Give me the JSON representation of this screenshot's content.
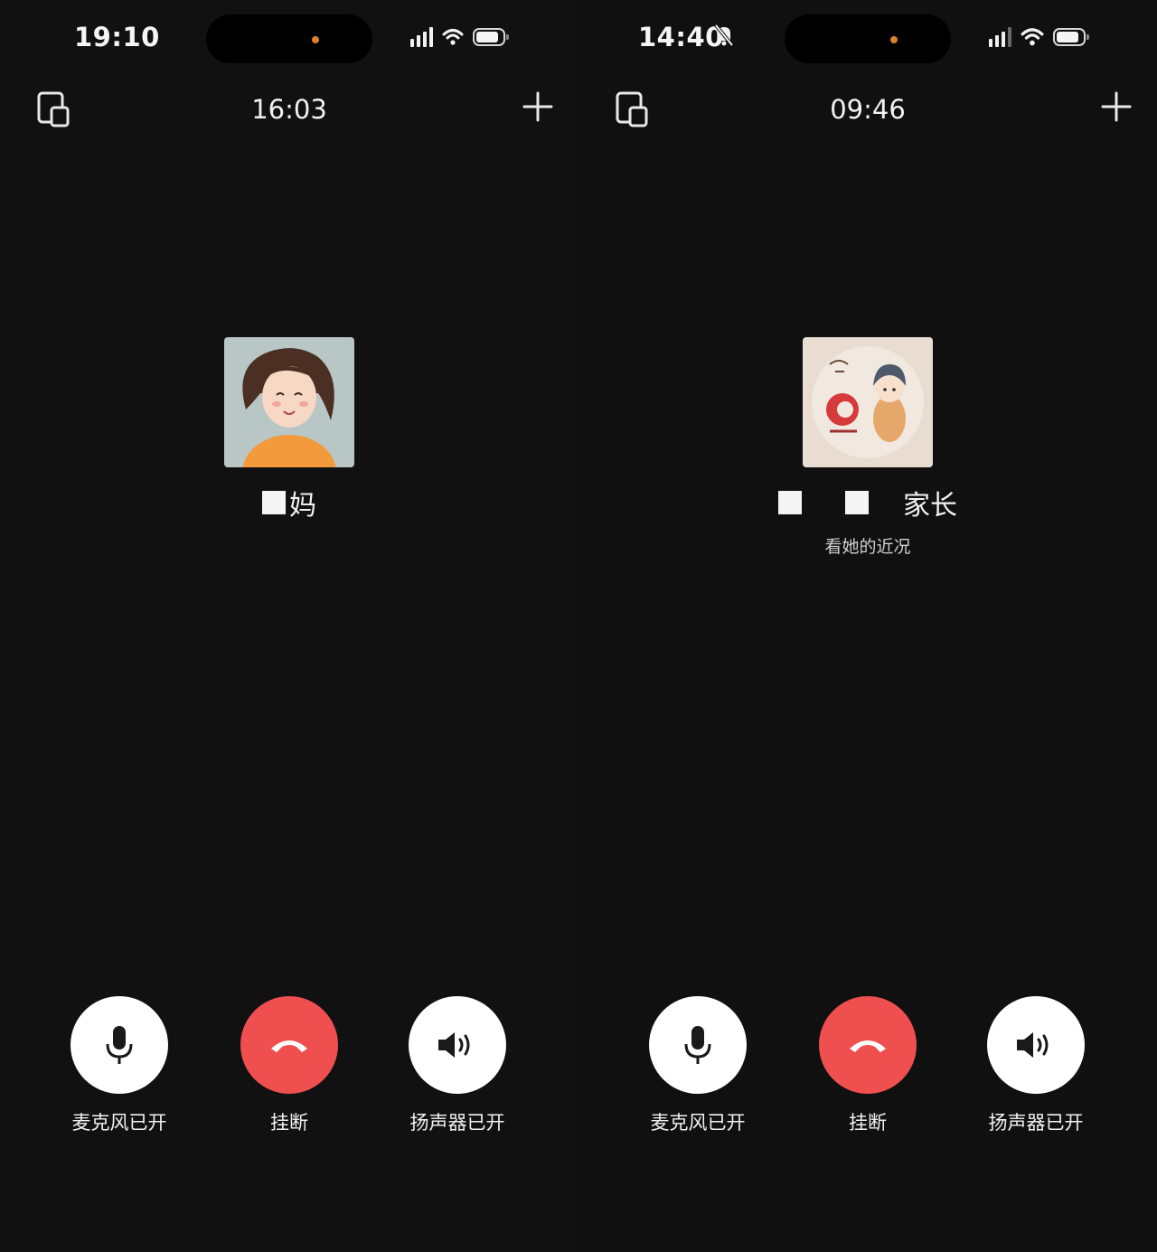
{
  "screens": [
    {
      "status_time": "19:10",
      "call_duration": "16:03",
      "contact_name_visible": "妈",
      "sub_status": "",
      "controls": {
        "mic_label": "麦克风已开",
        "hangup_label": "挂断",
        "speaker_label": "扬声器已开"
      }
    },
    {
      "status_time": "14:40",
      "call_duration": "09:46",
      "contact_name_visible": "家长",
      "sub_status": "看她的近况",
      "controls": {
        "mic_label": "麦克风已开",
        "hangup_label": "挂断",
        "speaker_label": "扬声器已开"
      }
    }
  ],
  "colors": {
    "background": "#111111",
    "hangup": "#ef4f4f",
    "button": "#ffffff",
    "text": "#f2f2f2",
    "camera_dot": "#d9822b"
  },
  "icons": [
    "minimize-window-icon",
    "add-icon",
    "microphone-icon",
    "hang-up-icon",
    "speaker-icon",
    "signal-icon",
    "wifi-icon",
    "battery-icon",
    "silent-bell-icon"
  ]
}
